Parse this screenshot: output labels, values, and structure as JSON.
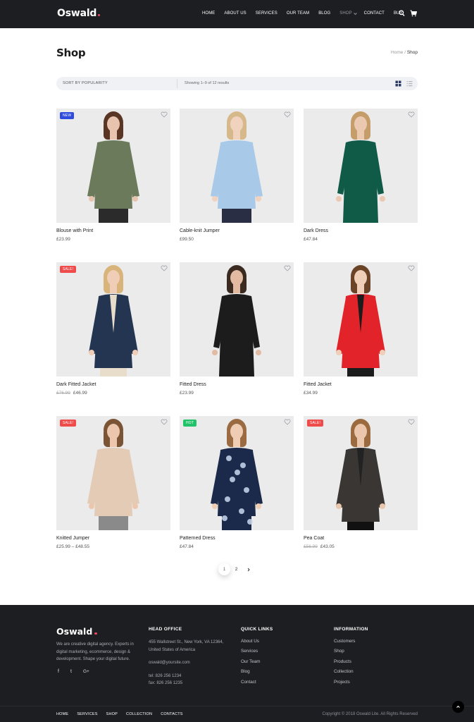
{
  "brand": {
    "name": "Oswald",
    "dot_color": "#e84a5f"
  },
  "header": {
    "nav": [
      {
        "label": "HOME"
      },
      {
        "label": "ABOUT US"
      },
      {
        "label": "SERVICES"
      },
      {
        "label": "OUR TEAM"
      },
      {
        "label": "BLOG"
      },
      {
        "label": "SHOP"
      },
      {
        "label": "CONTACT"
      },
      {
        "label": "BUY"
      }
    ],
    "active": "SHOP",
    "icons": [
      "search-icon",
      "cart-icon",
      "chevron-down-icon"
    ]
  },
  "page": {
    "title": "Shop",
    "breadcrumb": {
      "home": "Home",
      "separator": " / ",
      "current": "Shop"
    }
  },
  "toolbar": {
    "sort_label": "SORT BY POPULARITY",
    "results_text": "Showing 1–9 of 12 results",
    "icons": [
      "grid-view-icon",
      "list-view-icon"
    ]
  },
  "products": [
    {
      "name": "Blouse with Print",
      "price": "£23.99",
      "old_price": "",
      "badge": "NEW",
      "badge_color": "#2e4be0"
    },
    {
      "name": "Cable-knit Jumper",
      "price": "£99.50",
      "old_price": "",
      "badge": "",
      "badge_color": ""
    },
    {
      "name": "Dark Dress",
      "price": "£47.84",
      "old_price": "",
      "badge": "",
      "badge_color": ""
    },
    {
      "name": "Dark Fitted Jacket",
      "price": "£46.99",
      "old_price": "£76.99",
      "badge": "SALE!",
      "badge_color": "#ef4b4b"
    },
    {
      "name": "Fitted Dress",
      "price": "£23.99",
      "old_price": "",
      "badge": "",
      "badge_color": ""
    },
    {
      "name": "Fitted Jacket",
      "price": "£34.99",
      "old_price": "",
      "badge": "",
      "badge_color": ""
    },
    {
      "name": "Knitted Jumper",
      "price": "£25.99 – £48.55",
      "old_price": "",
      "badge": "SALE!",
      "badge_color": "#ef4b4b"
    },
    {
      "name": "Patterned Dress",
      "price": "£47.84",
      "old_price": "",
      "badge": "HOT",
      "badge_color": "#22c26b"
    },
    {
      "name": "Pea Coat",
      "price": "£43.05",
      "old_price": "£56.99",
      "badge": "SALE!",
      "badge_color": "#ef4b4b"
    }
  ],
  "pagination": {
    "pages": [
      "1",
      "2"
    ],
    "current": "1",
    "next_icon": "chevron-right-icon"
  },
  "footer": {
    "logo": "Oswald",
    "about": "We are creative digital agency. Experts in digital marketing, ecommerce, design & development. Shape your digital future.",
    "social": [
      "f",
      "t",
      "G+"
    ],
    "head_office": {
      "title": "HEAD OFFICE",
      "address_1": "455 Wallstreet St., New York, VA 12364,",
      "address_2": "United States of America",
      "email": "oswald@yoursite.com",
      "tel": "tel: 826 256 1234",
      "fax": "fax: 826 256 1235"
    },
    "quick_links": {
      "title": "QUICK LINKS",
      "items": [
        "About Us",
        "Services",
        "Our Team",
        "Blog",
        "Contact"
      ]
    },
    "information": {
      "title": "INFORMATION",
      "items": [
        "Customers",
        "Shop",
        "Products",
        "Collection",
        "Projects"
      ]
    },
    "bottom_nav": [
      "HOME",
      "SERVICES",
      "SHOP",
      "COLLECTION",
      "CONTACTS"
    ],
    "copyright": "Copyright © 2018 Oswald Lite. All Rights Reserved"
  }
}
